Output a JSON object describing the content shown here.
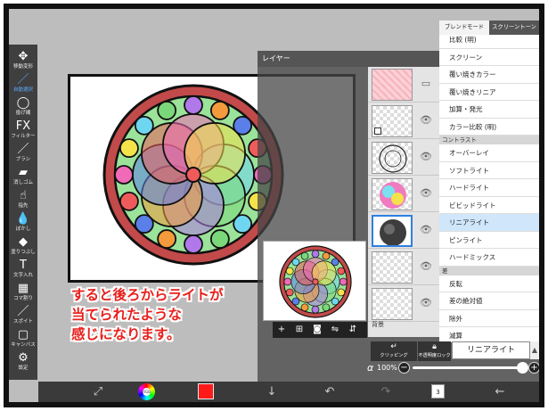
{
  "left_toolbar": {
    "tools": [
      {
        "icon": "move-transform-icon",
        "glyph": "✥",
        "label": "移動変形"
      },
      {
        "icon": "lasso-icon",
        "glyph": "／",
        "label": "自動選択"
      },
      {
        "icon": "lasso-select-icon",
        "glyph": "◯",
        "label": "投げ縄"
      },
      {
        "icon": "filter-icon",
        "glyph": "FX",
        "label": "フィルター"
      },
      {
        "icon": "brush-icon",
        "glyph": "／",
        "label": "ブラシ"
      },
      {
        "icon": "eraser-icon",
        "glyph": "▰",
        "label": "消しゴム"
      },
      {
        "icon": "smudge-icon",
        "glyph": "☝",
        "label": "指先"
      },
      {
        "icon": "blur-icon",
        "glyph": "💧",
        "label": "ぼかし"
      },
      {
        "icon": "fill-icon",
        "glyph": "◆",
        "label": "塗りつぶし"
      },
      {
        "icon": "text-icon",
        "glyph": "T",
        "label": "文字入れ"
      },
      {
        "icon": "frame-divider-icon",
        "glyph": "▦",
        "label": "コマ割り"
      },
      {
        "icon": "eyedropper-icon",
        "glyph": "／",
        "label": "スポイト"
      },
      {
        "icon": "canvas-icon",
        "glyph": "▢",
        "label": "キャンバス"
      },
      {
        "icon": "settings-icon",
        "glyph": "⚙",
        "label": "設定"
      }
    ],
    "active_index": 1
  },
  "annotation": {
    "line1": "すると後ろからライトが",
    "line2": "当てられたような",
    "line3": "感じになります。"
  },
  "layer_panel": {
    "title": "レイヤー",
    "background_label": "背景",
    "selected_layer_index": 4
  },
  "preview_toolbar": {
    "buttons": [
      "+",
      "⊞",
      "◙",
      "⇋",
      "⇵"
    ]
  },
  "blend_menu": {
    "tabs": [
      "ブレンドモード",
      "スクリーントーン"
    ],
    "active_tab": 0,
    "items_before": [
      "比較 (明)",
      "スクリーン",
      "覆い焼きカラー",
      "覆い焼きリニア",
      "加算・発光",
      "カラー比較 (明)"
    ],
    "section_contrast": "コントラスト",
    "items_contrast": [
      "オーバーレイ",
      "ソフトライト",
      "ハードライト",
      "ビビッドライト",
      "リニアライト",
      "ピンライト",
      "ハードミックス"
    ],
    "section_difference": "差",
    "items_difference": [
      "反転",
      "差の絶対値",
      "除外",
      "減算"
    ],
    "selected_item": "リニアライト"
  },
  "layer_footer": {
    "clipping_label": "クリッピング",
    "alpha_lock_label": "不透明度ロック",
    "mode_value": "リニアライト",
    "alpha_symbol": "α",
    "opacity_text": "100%",
    "opacity_value": 1.0
  },
  "bottom_bar": {
    "page_number": "3",
    "primary_color": "#ff1a1a"
  }
}
